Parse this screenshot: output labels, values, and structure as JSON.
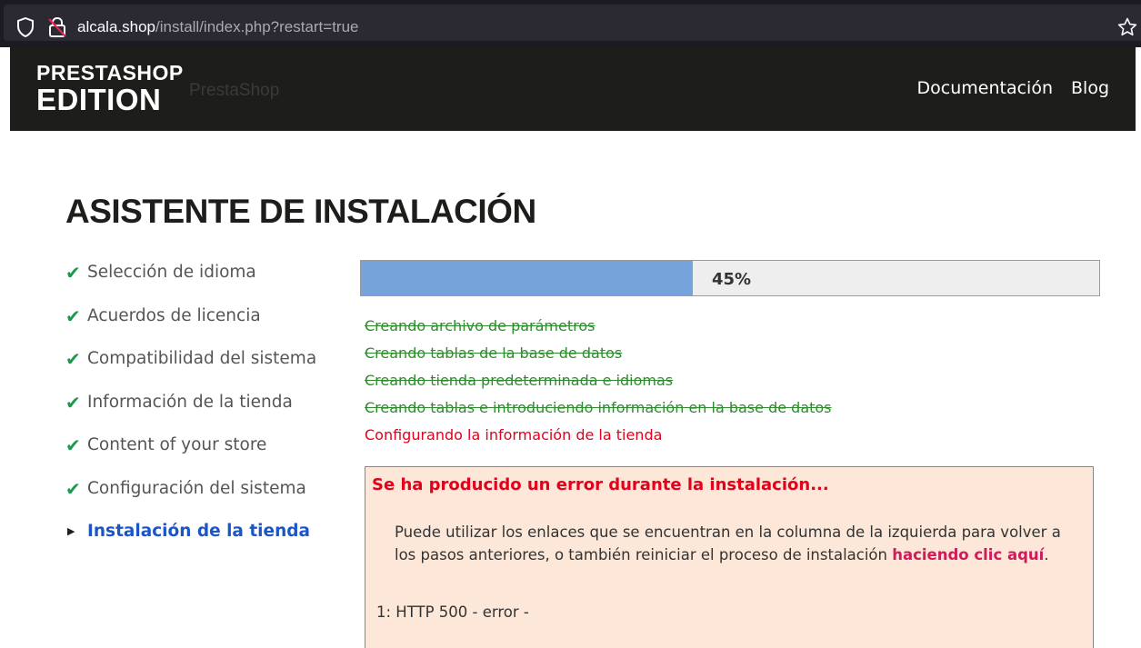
{
  "browser": {
    "url_host": "alcala.shop",
    "url_path": "/install/index.php?restart=true"
  },
  "header": {
    "logo_top": "PRESTASHOP",
    "logo_bottom": "EDITION",
    "logo_ghost": "PrestaShop",
    "nav": [
      "Documentación",
      "Blog"
    ]
  },
  "page_title": "ASISTENTE DE INSTALACIÓN",
  "steps": [
    {
      "label": "Selección de idioma",
      "status": "done"
    },
    {
      "label": "Acuerdos de licencia",
      "status": "done"
    },
    {
      "label": "Compatibilidad del sistema",
      "status": "done"
    },
    {
      "label": "Información de la tienda",
      "status": "done"
    },
    {
      "label": "Content of your store",
      "status": "done"
    },
    {
      "label": "Configuración del sistema",
      "status": "done"
    },
    {
      "label": "Instalación de la tienda",
      "status": "current"
    }
  ],
  "progress": {
    "value": 45,
    "label": "45%"
  },
  "tasks": [
    {
      "label": "Creando archivo de parámetros",
      "status": "done"
    },
    {
      "label": "Creando tablas de la base de datos",
      "status": "done"
    },
    {
      "label": "Creando tienda predeterminada e idiomas",
      "status": "done"
    },
    {
      "label": "Creando tablas e introduciendo información en la base de datos",
      "status": "done"
    },
    {
      "label": "Configurando la información de la tienda",
      "status": "active"
    }
  ],
  "error": {
    "title": "Se ha producido un error durante la instalación...",
    "message_before": "Puede utilizar los enlaces que se encuentran en la columna de la izquierda para volver a los pasos anteriores, o también reiniciar el proceso de instalación ",
    "link": "haciendo clic aquí",
    "message_after": ".",
    "code": "1: HTTP 500 - error -"
  },
  "colors": {
    "header_bg": "#1d1d1b",
    "check_green": "#1a9a4a",
    "current_step_blue": "#1a56c8",
    "progress_fill": "#76a3d9",
    "task_done_green": "#2e8b2e",
    "task_active_red": "#e4001b",
    "error_bg": "#fce7d8",
    "error_link": "#d11a5a"
  },
  "icons": {
    "done_step": "checkmark-icon",
    "current_step": "triangle-right-icon"
  }
}
